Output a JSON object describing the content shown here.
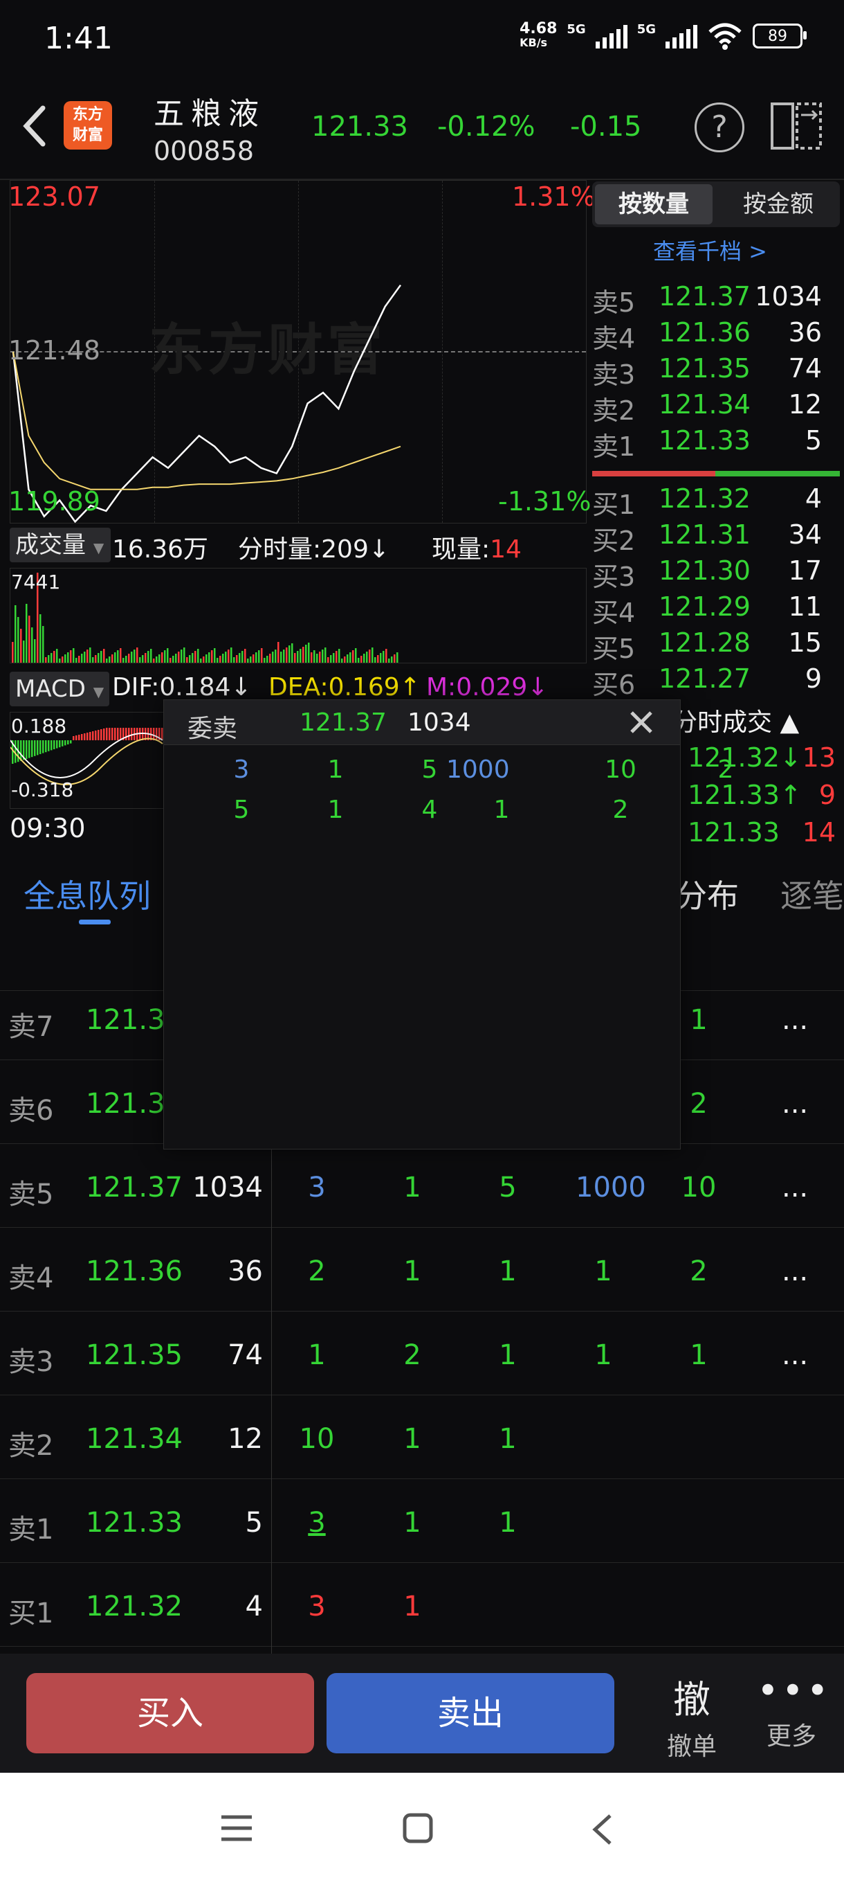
{
  "status_bar": {
    "time": "1:41",
    "speed": "4.68",
    "speed_unit": "KB/s",
    "net1": "5G",
    "net2": "5G",
    "battery": "89"
  },
  "header": {
    "logo_line1": "东方",
    "logo_line2": "财富",
    "name": "五粮液",
    "code": "000858",
    "price": "121.33",
    "change_pct": "-0.12%",
    "change": "-0.15"
  },
  "chart": {
    "high": "123.07",
    "high_pct": "1.31%",
    "mid": "121.48",
    "low": "119.89",
    "low_pct": "-1.31%",
    "watermark": "东方财富",
    "volume_label": "成交量",
    "volume_total": "16.36万",
    "tick_vol_label": "分时量:209↓",
    "cur_vol_label": "现量:",
    "cur_vol": "14",
    "vol_max": "7441",
    "macd_label": "MACD",
    "dif": "DIF:0.184↓",
    "dea": "DEA:0.169↑",
    "m": "M:0.029↓",
    "macd_top": "0.188",
    "macd_bottom": "-0.318",
    "time_start": "09:30",
    "colors": {
      "price_line": "#ffffff",
      "avg_line": "#f5d76e",
      "up": "#ff3b3b",
      "down": "#35d535"
    }
  },
  "chart_data": {
    "type": "line",
    "title": "",
    "ylim": [
      119.89,
      123.07
    ],
    "series": [
      {
        "values": [
          121.48,
          120.2,
          119.95,
          120.1,
          119.9,
          120.05,
          120.0,
          120.2,
          120.35,
          120.5,
          120.4,
          120.55,
          120.7,
          120.6,
          120.45,
          120.5,
          120.4,
          120.35,
          120.6,
          121.0,
          121.1,
          120.95,
          121.3,
          121.6,
          121.9,
          122.1
        ]
      },
      {
        "values": [
          121.48,
          120.7,
          120.45,
          120.3,
          120.25,
          120.2,
          120.2,
          120.2,
          120.2,
          120.22,
          120.22,
          120.24,
          120.25,
          120.25,
          120.25,
          120.26,
          120.27,
          120.28,
          120.3,
          120.33,
          120.36,
          120.4,
          120.45,
          120.5,
          120.55,
          120.6
        ]
      }
    ]
  },
  "right_panel": {
    "tab1": "按数量",
    "tab2": "按金额",
    "link": "查看千档 >",
    "asks": [
      {
        "label": "卖5",
        "price": "121.37",
        "vol": "1034"
      },
      {
        "label": "卖4",
        "price": "121.36",
        "vol": "36"
      },
      {
        "label": "卖3",
        "price": "121.35",
        "vol": "74"
      },
      {
        "label": "卖2",
        "price": "121.34",
        "vol": "12"
      },
      {
        "label": "卖1",
        "price": "121.33",
        "vol": "5"
      }
    ],
    "bids": [
      {
        "label": "买1",
        "price": "121.32",
        "vol": "4"
      },
      {
        "label": "买2",
        "price": "121.31",
        "vol": "34"
      },
      {
        "label": "买3",
        "price": "121.30",
        "vol": "17"
      },
      {
        "label": "买4",
        "price": "121.29",
        "vol": "11"
      },
      {
        "label": "买5",
        "price": "121.28",
        "vol": "15"
      },
      {
        "label": "买6",
        "price": "121.27",
        "vol": "9"
      }
    ],
    "trades_title": "分时成交",
    "trades": [
      {
        "price": "121.32↓",
        "vol": "13"
      },
      {
        "price": "121.33↑",
        "vol": "9"
      },
      {
        "price": "121.33",
        "vol": "14"
      }
    ]
  },
  "popup": {
    "title": "委卖",
    "price": "121.37",
    "vol": "1034",
    "row1": [
      "3",
      "1",
      "5",
      "1000",
      "10",
      "2"
    ],
    "row2": [
      "5",
      "1",
      "4",
      "1",
      "2"
    ]
  },
  "tabs": {
    "queue": "全息队列",
    "dist": "分布",
    "tick": "逐笔"
  },
  "queue": [
    {
      "label": "卖7",
      "price": "121.39",
      "vol": "",
      "orders": [
        "1"
      ],
      "more": "..."
    },
    {
      "label": "卖6",
      "price": "121.38",
      "vol": "",
      "orders": [
        "2"
      ],
      "more": "..."
    },
    {
      "label": "卖5",
      "price": "121.37",
      "vol": "1034",
      "orders": [
        "3",
        "1",
        "5",
        "1000",
        "10"
      ],
      "more": "..."
    },
    {
      "label": "卖4",
      "price": "121.36",
      "vol": "36",
      "orders": [
        "2",
        "1",
        "1",
        "1",
        "2"
      ],
      "more": "..."
    },
    {
      "label": "卖3",
      "price": "121.35",
      "vol": "74",
      "orders": [
        "1",
        "2",
        "1",
        "1",
        "1"
      ],
      "more": "..."
    },
    {
      "label": "卖2",
      "price": "121.34",
      "vol": "12",
      "orders": [
        "10",
        "1",
        "1"
      ],
      "more": ""
    },
    {
      "label": "卖1",
      "price": "121.33",
      "vol": "5",
      "orders": [
        "3",
        "1",
        "1"
      ],
      "more": ""
    },
    {
      "label": "买1",
      "price": "121.32",
      "vol": "4",
      "orders": [
        "3",
        "1"
      ],
      "more": ""
    }
  ],
  "bottom": {
    "buy": "买入",
    "sell": "卖出",
    "cancel_icon": "撤",
    "cancel": "撤单",
    "more": "更多"
  }
}
